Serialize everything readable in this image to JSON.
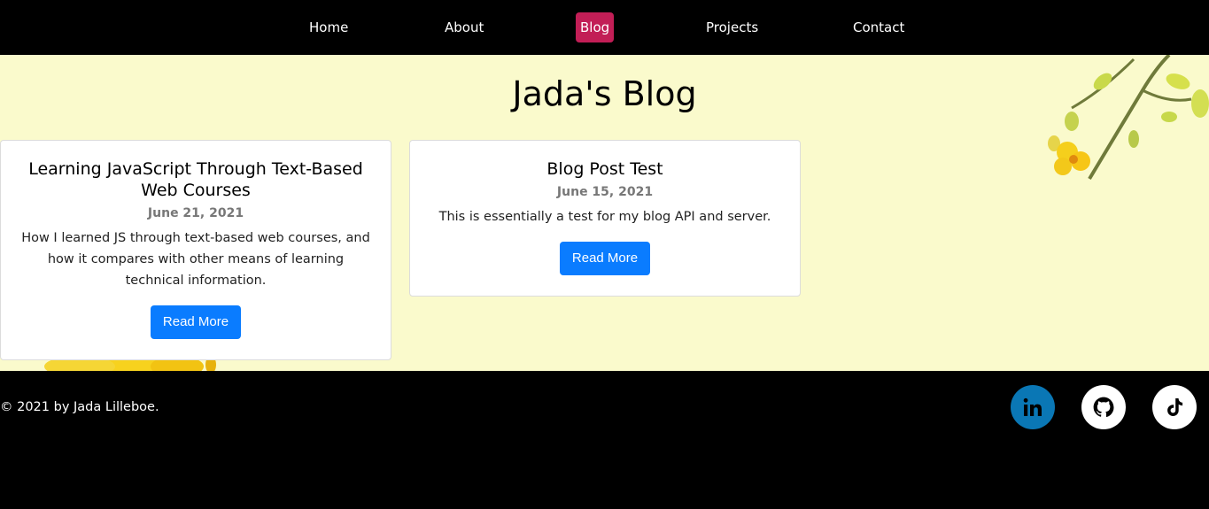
{
  "nav": {
    "items": [
      {
        "label": "Home"
      },
      {
        "label": "About"
      },
      {
        "label": "Blog",
        "active": true
      },
      {
        "label": "Projects"
      },
      {
        "label": "Contact"
      }
    ],
    "active_color": "#c21e56"
  },
  "main": {
    "title": "Jada's Blog",
    "background_color": "#fafacc"
  },
  "posts": [
    {
      "title": "Learning JavaScript Through Text-Based Web Courses",
      "date": "June 21, 2021",
      "summary": "How I learned JS through text-based web courses, and how it compares with other means of learning technical information.",
      "button_label": "Read More"
    },
    {
      "title": "Blog Post Test",
      "date": "June 15, 2021",
      "summary": "This is essentially a test for my blog API and server.",
      "button_label": "Read More"
    }
  ],
  "button_color": "#0a7cff",
  "footer": {
    "copyright": "© 2021 by Jada Lilleboe.",
    "social": [
      {
        "icon": "linkedin-icon",
        "color": "#0a77b5"
      },
      {
        "icon": "github-icon",
        "color": "#ffffff"
      },
      {
        "icon": "tiktok-icon",
        "color": "#ffffff"
      }
    ]
  }
}
